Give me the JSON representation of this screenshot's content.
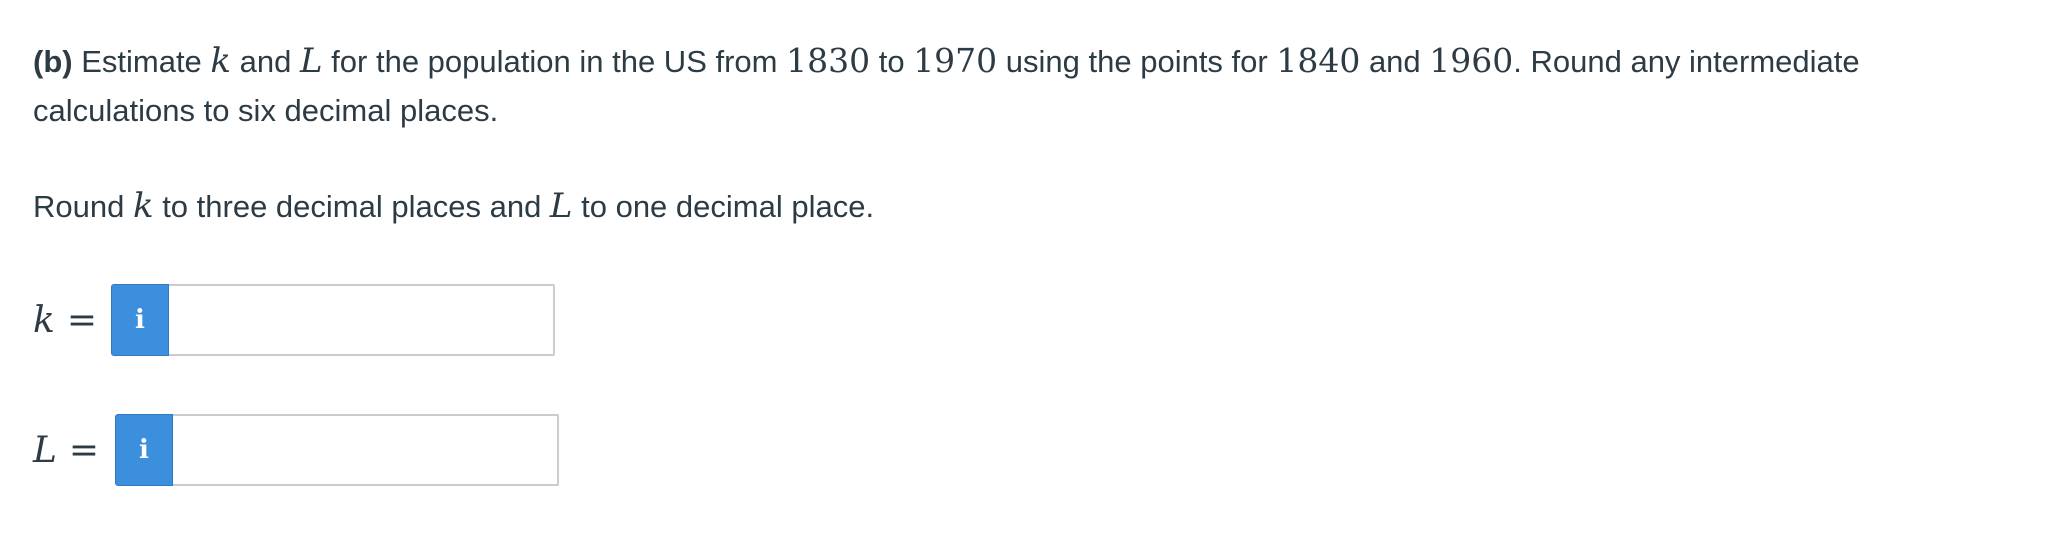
{
  "question": {
    "part_label": "(b)",
    "line1": {
      "t1": " Estimate ",
      "var_k": "k",
      "t2": " and ",
      "var_L": "L",
      "t3": " for the population in the US from ",
      "year1": "1830",
      "t4": " to ",
      "year2": "1970",
      "t5": " using the points for ",
      "year3": "1840",
      "t6": " and ",
      "year4": "1960",
      "t7": ". Round any intermediate calculations to six decimal places."
    },
    "line2": {
      "t1": "Round ",
      "var_k": "k",
      "t2": " to three decimal places and ",
      "var_L": "L",
      "t3": " to one decimal place."
    }
  },
  "answers": [
    {
      "variable": "k",
      "equals": "=",
      "info_icon": "i",
      "value": ""
    },
    {
      "variable": "L",
      "equals": "=",
      "info_icon": "i",
      "value": ""
    }
  ],
  "colors": {
    "text": "#2d3b45",
    "info_button": "#3b8fdd",
    "input_border": "#c9cdd1"
  },
  "icons": {
    "info_icon": "info-icon"
  }
}
